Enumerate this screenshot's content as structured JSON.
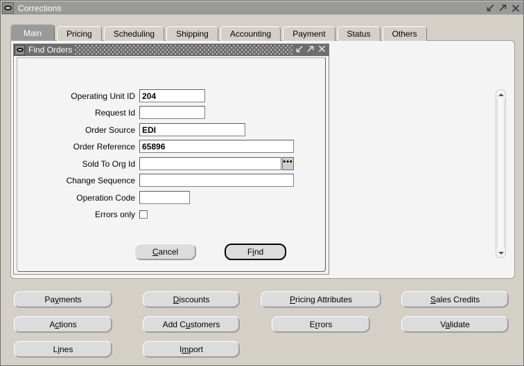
{
  "window": {
    "title": "Corrections",
    "sysmenu_icon": "oval-system-menu-icon",
    "controls": [
      {
        "name": "minimize",
        "icon": "minimize-icon"
      },
      {
        "name": "maximize",
        "icon": "maximize-icon"
      },
      {
        "name": "close",
        "icon": "close-icon"
      }
    ]
  },
  "tabs": [
    {
      "label": "Main",
      "active": true
    },
    {
      "label": "Pricing",
      "active": false
    },
    {
      "label": "Scheduling",
      "active": false
    },
    {
      "label": "Shipping",
      "active": false
    },
    {
      "label": "Accounting",
      "active": false
    },
    {
      "label": "Payment",
      "active": false
    },
    {
      "label": "Status",
      "active": false
    },
    {
      "label": "Others",
      "active": false
    }
  ],
  "scrollbar": {
    "up_icon": "scroll-up-arrow-icon",
    "down_icon": "scroll-down-arrow-icon"
  },
  "dialog": {
    "title": "Find Orders",
    "sysmenu_icon": "oval-system-menu-icon",
    "controls": [
      {
        "name": "minimize",
        "icon": "minimize-icon"
      },
      {
        "name": "maximize",
        "icon": "maximize-icon"
      },
      {
        "name": "close",
        "icon": "close-icon"
      }
    ],
    "fields": [
      {
        "label": "Operating Unit ID",
        "value": "204",
        "placeholder": ""
      },
      {
        "label": "Request Id",
        "value": "",
        "placeholder": ""
      },
      {
        "label": "Order Source",
        "value": "EDI",
        "placeholder": ""
      },
      {
        "label": "Order Reference",
        "value": "65896",
        "placeholder": ""
      },
      {
        "label": "Sold To Org Id",
        "value": "",
        "placeholder": "",
        "lov": true,
        "lov_glyph": "•••"
      },
      {
        "label": "Change Sequence",
        "value": "",
        "placeholder": ""
      },
      {
        "label": "Operation Code",
        "value": "",
        "placeholder": ""
      }
    ],
    "checkbox": {
      "label": "Errors only",
      "checked": false
    },
    "buttons": {
      "cancel": {
        "label": "Cancel",
        "mnemonic": "C"
      },
      "find": {
        "label": "Find",
        "mnemonic": "i",
        "default": true
      }
    }
  },
  "bottom_buttons": [
    {
      "label": "Payments",
      "mnemonic": "y"
    },
    {
      "label": "Discounts",
      "mnemonic": "D"
    },
    {
      "label": "Pricing Attributes",
      "mnemonic": "P"
    },
    {
      "label": "Sales Credits",
      "mnemonic": "S"
    },
    {
      "label": "Actions",
      "mnemonic": "c"
    },
    {
      "label": "Add Customers",
      "mnemonic": "u"
    },
    {
      "label": "Errors",
      "mnemonic": "r"
    },
    {
      "label": "Validate",
      "mnemonic": "a"
    },
    {
      "label": "Lines",
      "mnemonic": "i"
    },
    {
      "label": "Import",
      "mnemonic": "m"
    }
  ],
  "colors": {
    "window_chrome": "#9a9a9a",
    "dialog_titlebar": "#6e6e6e",
    "canvas": "#f4f4f4",
    "button_face": "#dcdcdc",
    "active_tab": "#9a9a9a"
  }
}
